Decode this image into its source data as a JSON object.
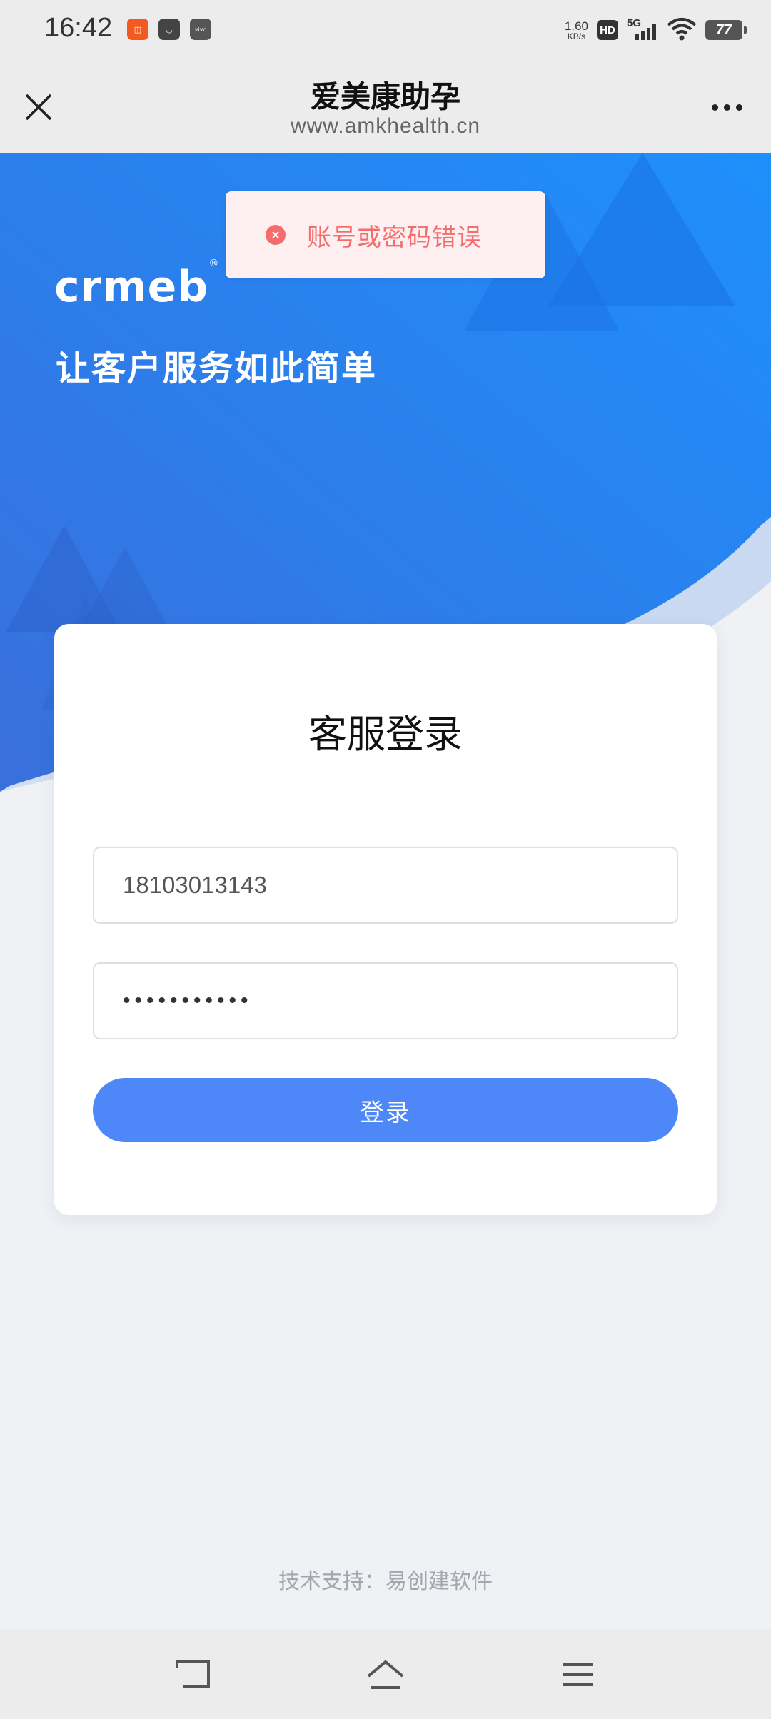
{
  "status_bar": {
    "time": "16:42",
    "net_speed_value": "1.60",
    "net_speed_unit": "KB/s",
    "hd_label": "HD",
    "network_label": "5G",
    "battery_level": "77"
  },
  "title_bar": {
    "title": "爱美康助孕",
    "url": "www.amkhealth.cn"
  },
  "hero": {
    "brand": "crmeb",
    "brand_mark": "®",
    "slogan": "让客户服务如此简单",
    "colors": {
      "primary": "#1e88f5",
      "secondary": "#3f6fd8"
    }
  },
  "toast": {
    "message": "账号或密码错误",
    "type": "error"
  },
  "login": {
    "title": "客服登录",
    "account_value": "18103013143",
    "password_mask": "•••••••••••",
    "submit_label": "登录",
    "button_color": "#4e87f8"
  },
  "footer": {
    "text": "技术支持：易创建软件"
  }
}
